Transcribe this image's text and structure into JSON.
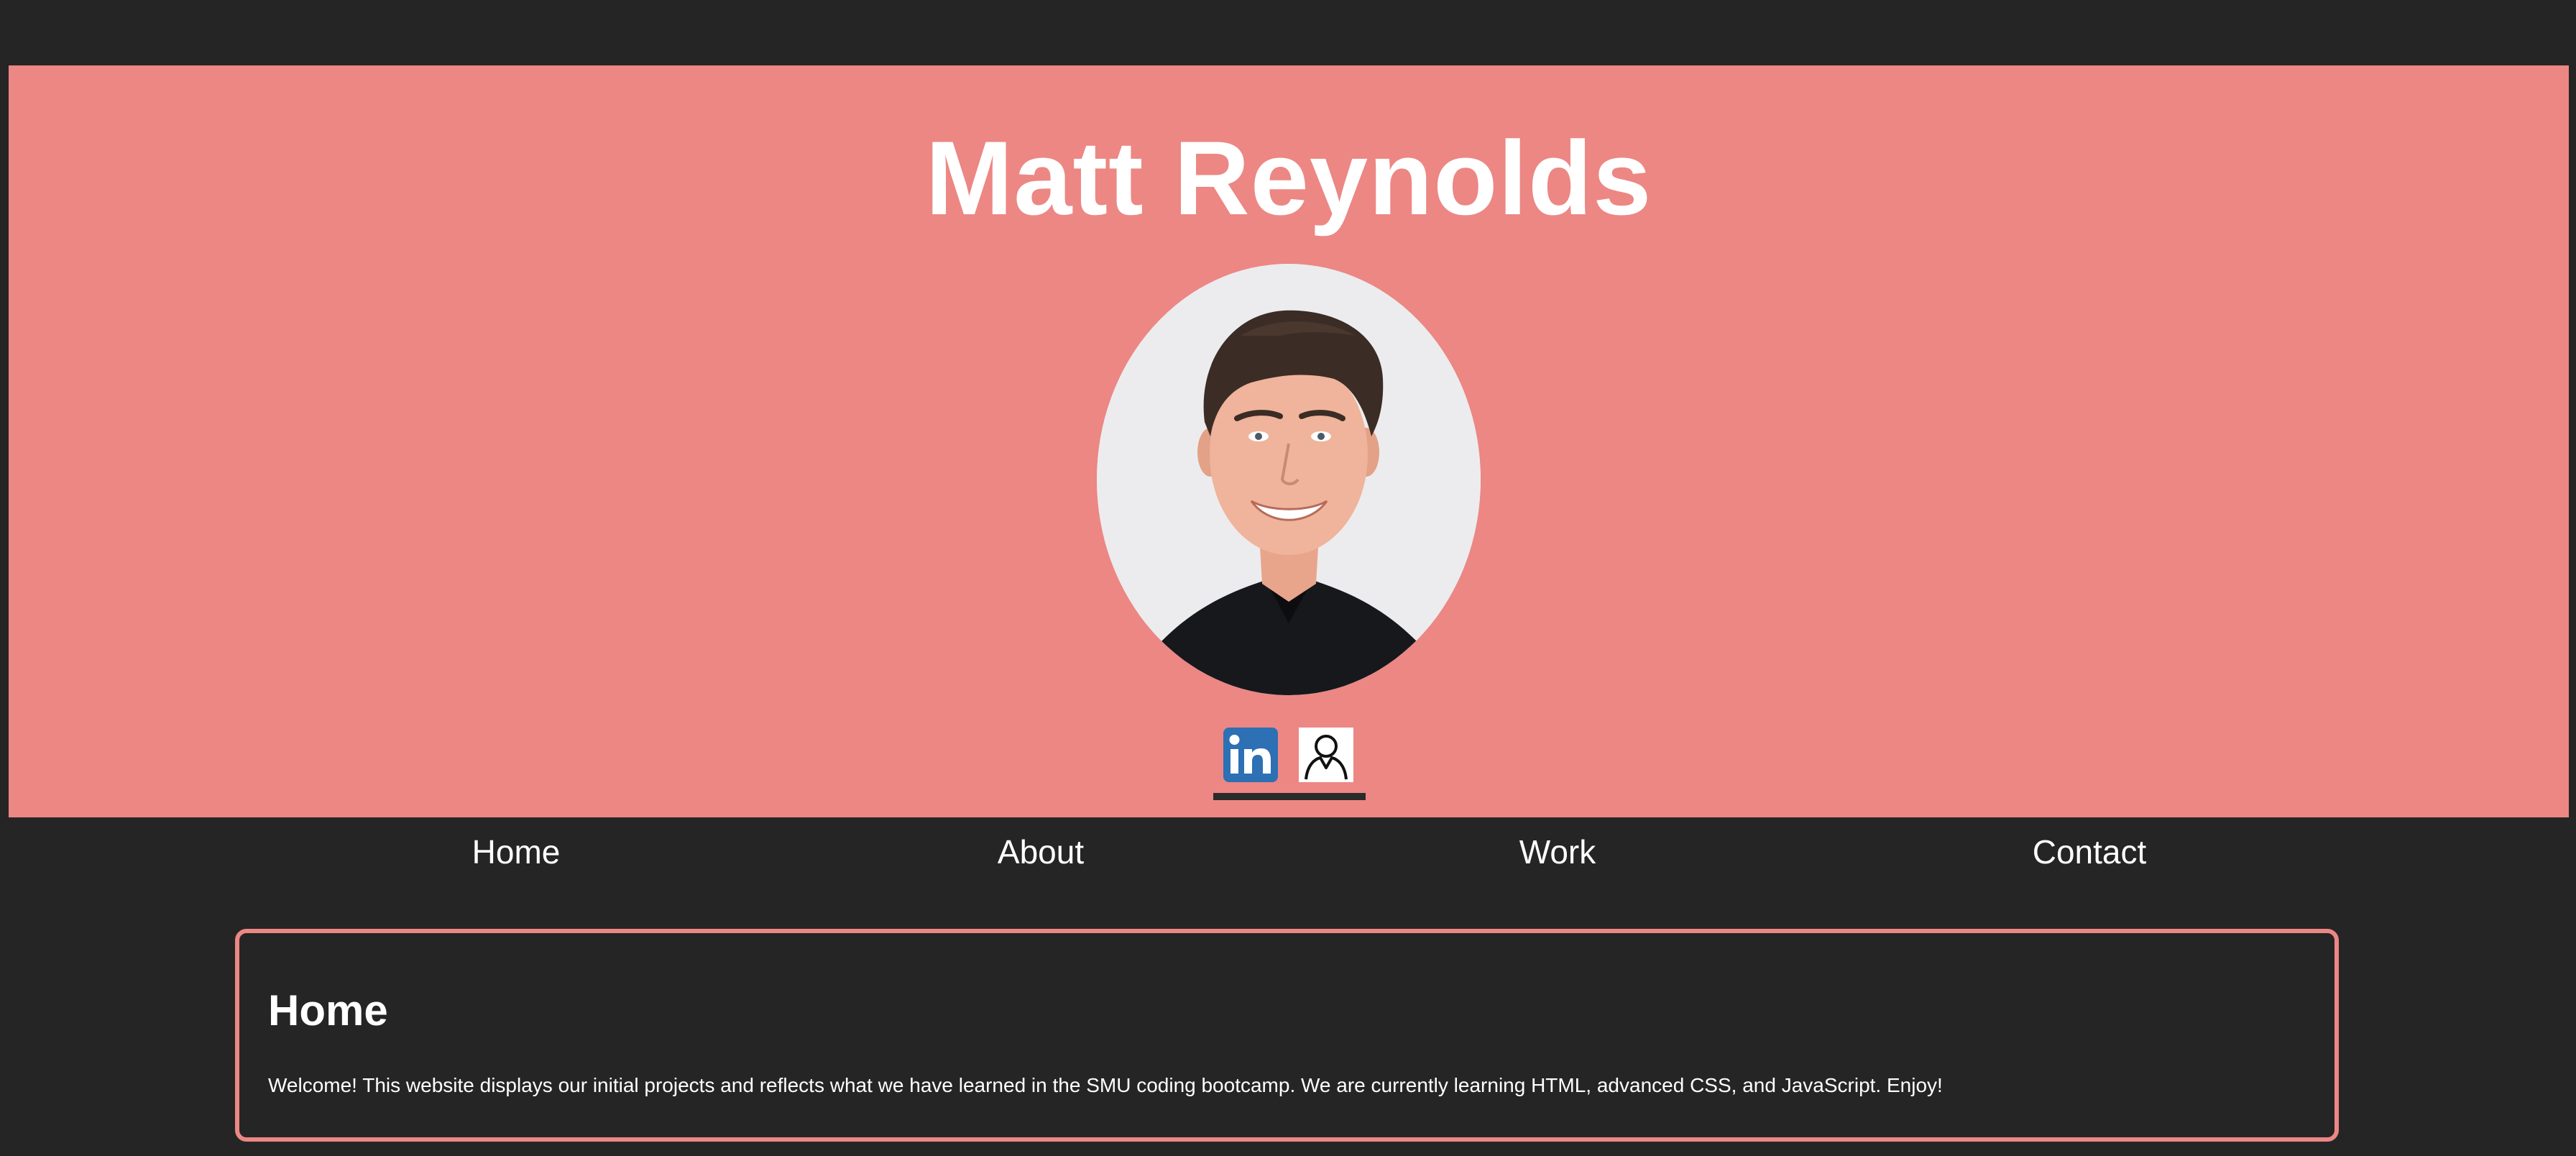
{
  "header": {
    "title": "Matt Reynolds",
    "background_color": "#ec8784",
    "profile_photo": "profile-photo",
    "social_links": [
      {
        "icon": "linkedin-icon"
      },
      {
        "icon": "resume-person-icon"
      }
    ]
  },
  "nav": {
    "items": [
      {
        "label": "Home"
      },
      {
        "label": "About"
      },
      {
        "label": "Work"
      },
      {
        "label": "Contact"
      }
    ]
  },
  "main": {
    "section_title": "Home",
    "section_text": "Welcome! This website displays our initial projects and reflects what we have learned in the SMU coding bootcamp. We are currently learning HTML, advanced CSS, and JavaScript. Enjoy!",
    "accent_color": "#ec8784",
    "background_color": "#252525"
  }
}
